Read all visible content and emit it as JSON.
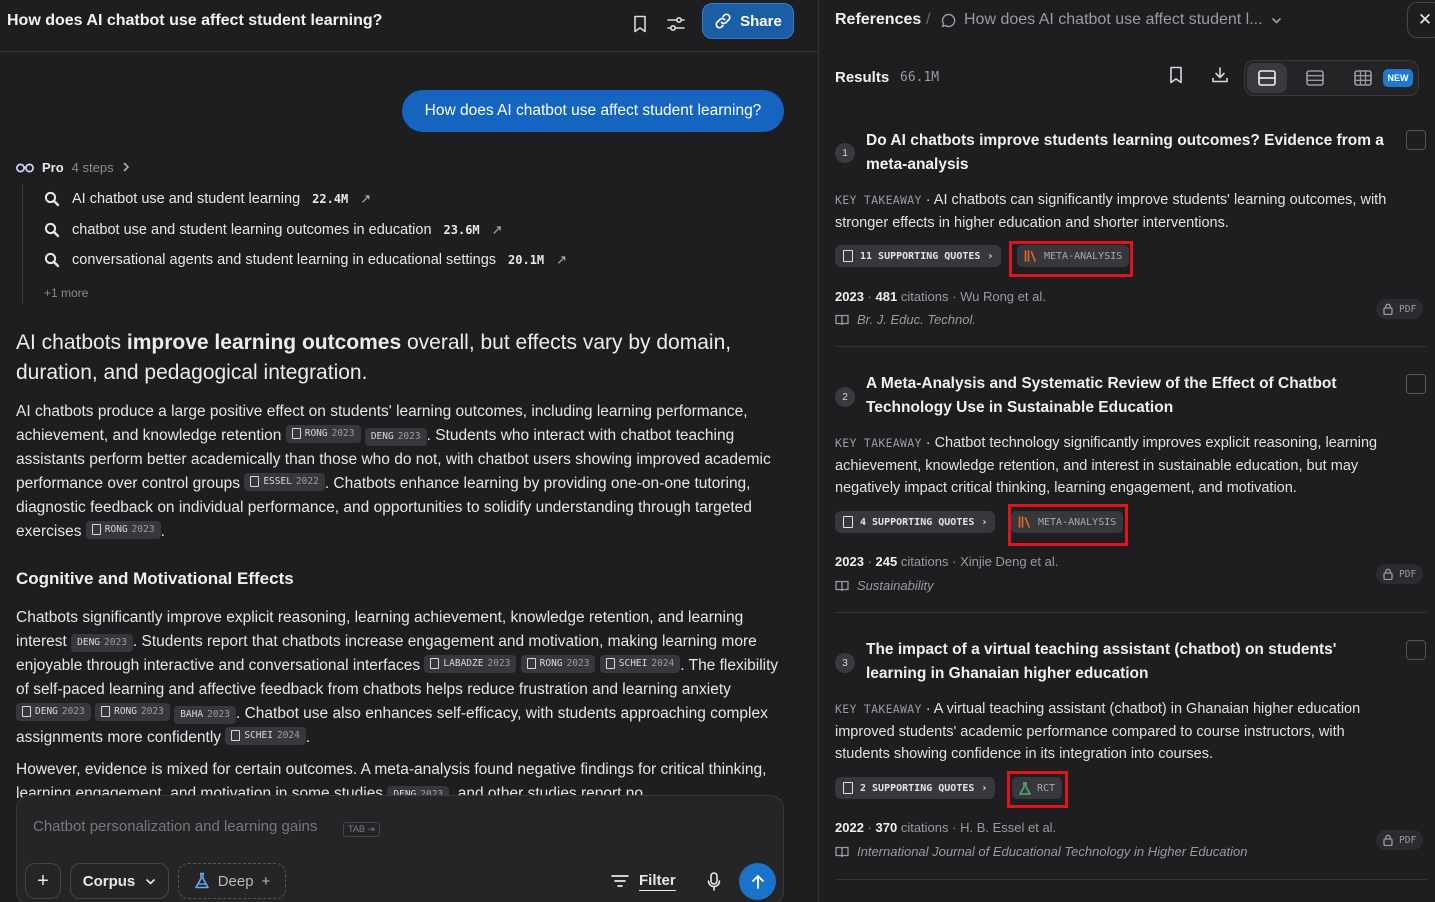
{
  "thread": {
    "title": "How does AI chatbot use affect student learning?",
    "share_label": "Share"
  },
  "user_query": "How does AI chatbot use affect student learning?",
  "pro": {
    "label": "Pro",
    "steps_label": "4 steps",
    "steps": [
      {
        "text": "AI chatbot use and student learning",
        "count": "22.4M"
      },
      {
        "text": "chatbot use and student learning outcomes in education",
        "count": "23.6M"
      },
      {
        "text": "conversational agents and student learning in educational settings",
        "count": "20.1M"
      }
    ],
    "more_label": "+1 more"
  },
  "answer": {
    "headline_pre": "AI chatbots ",
    "headline_bold": "improve learning outcomes",
    "headline_post": " overall, but effects vary by domain, duration, and pedagogical integration.",
    "p1": {
      "t1": "AI chatbots produce a large positive effect on students' learning outcomes, including learning performance, achievement, and knowledge retention ",
      "t2": ". Students who interact with chatbot teaching assistants perform better academically than those who do not, with chatbot users showing improved academic performance over control groups ",
      "t3": ". Chatbots enhance learning by providing one-on-one tutoring, diagnostic feedback on individual performance, and opportunities to solidify understanding through targeted exercises ",
      "t4": "."
    },
    "section_heading": "Cognitive and Motivational Effects",
    "p2": {
      "t1": "Chatbots significantly improve explicit reasoning, learning achievement, knowledge retention, and learning interest ",
      "t2": ". Students report that chatbots increase engagement and motivation, making learning more enjoyable through interactive and conversational interfaces ",
      "t3": ". The flexibility of self-paced learning and affective feedback from chatbots helps reduce frustration and learning anxiety ",
      "t4": ". Chatbot use also enhances self-efficacy, with students approaching complex assignments more confidently ",
      "t5": "."
    },
    "p3": {
      "t1": "However, evidence is mixed for certain outcomes. A meta-analysis found negative findings for critical thinking, learning engagement, and motivation in some studies ",
      "t2": ", and other studies report no"
    }
  },
  "cites": {
    "rong": {
      "name": "RONG",
      "year": "2023"
    },
    "deng": {
      "name": "DENG",
      "year": "2023"
    },
    "essel": {
      "name": "ESSEL",
      "year": "2022"
    },
    "labadze": {
      "name": "LABADZE",
      "year": "2023"
    },
    "schei": {
      "name": "SCHEI",
      "year": "2024"
    },
    "baha": {
      "name": "BAHA",
      "year": "2023"
    }
  },
  "composer": {
    "placeholder": "Chatbot personalization and learning gains",
    "tab_hint": "TAB ⇥",
    "corpus_label": "Corpus",
    "deep_label": "Deep",
    "filter_label": "Filter"
  },
  "references": {
    "label": "References",
    "separator": "/",
    "breadcrumb": "How does AI chatbot use affect student l...",
    "results_label": "Results",
    "results_count": "66.1M",
    "new_badge": "NEW",
    "key_takeaway_label": "KEY TAKEAWAY",
    "pdf_label": "PDF",
    "citations_word": "citations",
    "items": [
      {
        "num": "1",
        "title": "Do AI chatbots improve students learning outcomes? Evidence from a meta-analysis",
        "takeaway": "AI chatbots can significantly improve students' learning outcomes, with stronger effects in higher education and shorter interventions.",
        "quotes": "11 SUPPORTING QUOTES",
        "type": "META-ANALYSIS",
        "year": "2023",
        "citations": "481",
        "authors": "Wu Rong et al.",
        "journal": "Br. J. Educ. Technol."
      },
      {
        "num": "2",
        "title": "A Meta-Analysis and Systematic Review of the Effect of Chatbot Technology Use in Sustainable Education",
        "takeaway": "Chatbot technology significantly improves explicit reasoning, learning achievement, knowledge retention, and interest in sustainable education, but may negatively impact critical thinking, learning engagement, and motivation.",
        "quotes": "4 SUPPORTING QUOTES",
        "type": "META-ANALYSIS",
        "year": "2023",
        "citations": "245",
        "authors": "Xinjie Deng et al.",
        "journal": "Sustainability"
      },
      {
        "num": "3",
        "title": "The impact of a virtual teaching assistant (chatbot) on students' learning in Ghanaian higher education",
        "takeaway": "A virtual teaching assistant (chatbot) in Ghanaian higher education improved students' academic performance compared to course instructors, with students showing confidence in its integration into courses.",
        "quotes": "2 SUPPORTING QUOTES",
        "type": "RCT",
        "year": "2022",
        "citations": "370",
        "authors": "H. B. Essel et al.",
        "journal": "International Journal of Educational Technology in Higher Education"
      }
    ]
  },
  "colors": {
    "accent_blue": "#1565c0",
    "highlight_red": "#e0141f",
    "meta_analysis_orange": "#e06a2a",
    "rct_green": "#4caf7a"
  }
}
